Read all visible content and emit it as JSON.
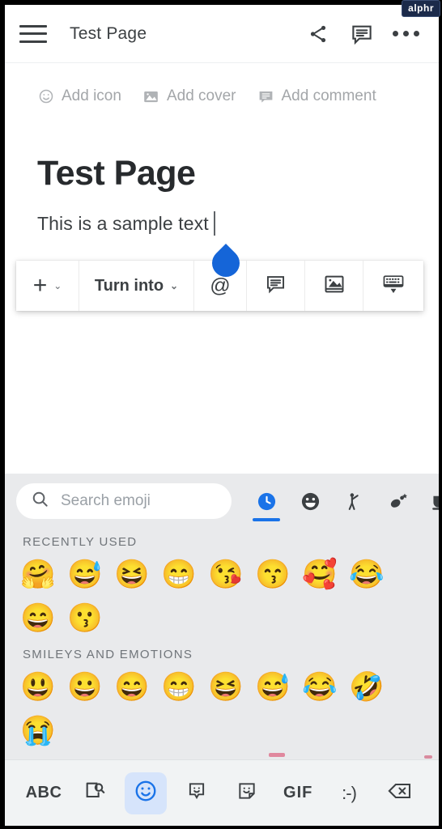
{
  "watermark": {
    "label": "alphr"
  },
  "header": {
    "title": "Test Page",
    "menu_icon": "hamburger-menu-icon",
    "share_icon": "share-icon",
    "comment_icon": "comment-icon",
    "overflow_icon": "more-options-icon"
  },
  "document": {
    "meta_actions": [
      {
        "label": "Add icon",
        "icon": "smiley-face-icon"
      },
      {
        "label": "Add cover",
        "icon": "image-icon"
      },
      {
        "label": "Add comment",
        "icon": "comment-icon"
      }
    ],
    "title": "Test Page",
    "body_text": "This is a sample text",
    "cursor_handle_color": "#1565d8"
  },
  "format_toolbar": {
    "add_label": "+",
    "add_chevron": "⌄",
    "turn_into_label": "Turn into",
    "turn_into_chevron": "⌄",
    "mention_label": "@",
    "comment_icon": "comment-icon",
    "image_icon": "insert-image-icon",
    "keyboard_icon": "hide-keyboard-icon"
  },
  "emoji_panel": {
    "search": {
      "placeholder": "Search emoji",
      "icon": "search-icon"
    },
    "categories": [
      {
        "name": "recent",
        "glyph": "🕓",
        "active": true
      },
      {
        "name": "smileys",
        "glyph": "😀",
        "active": false
      },
      {
        "name": "people",
        "glyph": "🧑",
        "active": false
      },
      {
        "name": "nature",
        "glyph": "🌿",
        "active": false
      },
      {
        "name": "food",
        "glyph": "☕",
        "active": false
      }
    ],
    "active_indicator_color": "#1a73e8",
    "sections": [
      {
        "label": "RECENTLY USED",
        "emojis": [
          "🤗",
          "😅",
          "😆",
          "😁",
          "😘",
          "😙",
          "🥰",
          "😂",
          "😄",
          "😗"
        ]
      },
      {
        "label": "SMILEYS AND EMOTIONS",
        "emojis": [
          "😃",
          "😀",
          "😄",
          "😁",
          "😆",
          "😅",
          "😂",
          "🤣",
          "😭"
        ]
      }
    ]
  },
  "keyboard_bar": {
    "buttons": [
      {
        "name": "abc-button",
        "label": "ABC",
        "type": "text",
        "active": false
      },
      {
        "name": "sticker-search-icon",
        "label": "",
        "type": "icon",
        "active": false
      },
      {
        "name": "emoji-icon",
        "label": "",
        "type": "icon",
        "active": true
      },
      {
        "name": "sticker-bubble-icon",
        "label": "",
        "type": "icon",
        "active": false
      },
      {
        "name": "sticker-note-icon",
        "label": "",
        "type": "icon",
        "active": false
      },
      {
        "name": "gif-button",
        "label": "GIF",
        "type": "text",
        "active": false
      },
      {
        "name": "emoticon-button",
        "label": ":-)",
        "type": "text",
        "active": false
      },
      {
        "name": "backspace-icon",
        "label": "",
        "type": "icon",
        "active": false
      }
    ],
    "active_bg": "#d6e4fb"
  }
}
